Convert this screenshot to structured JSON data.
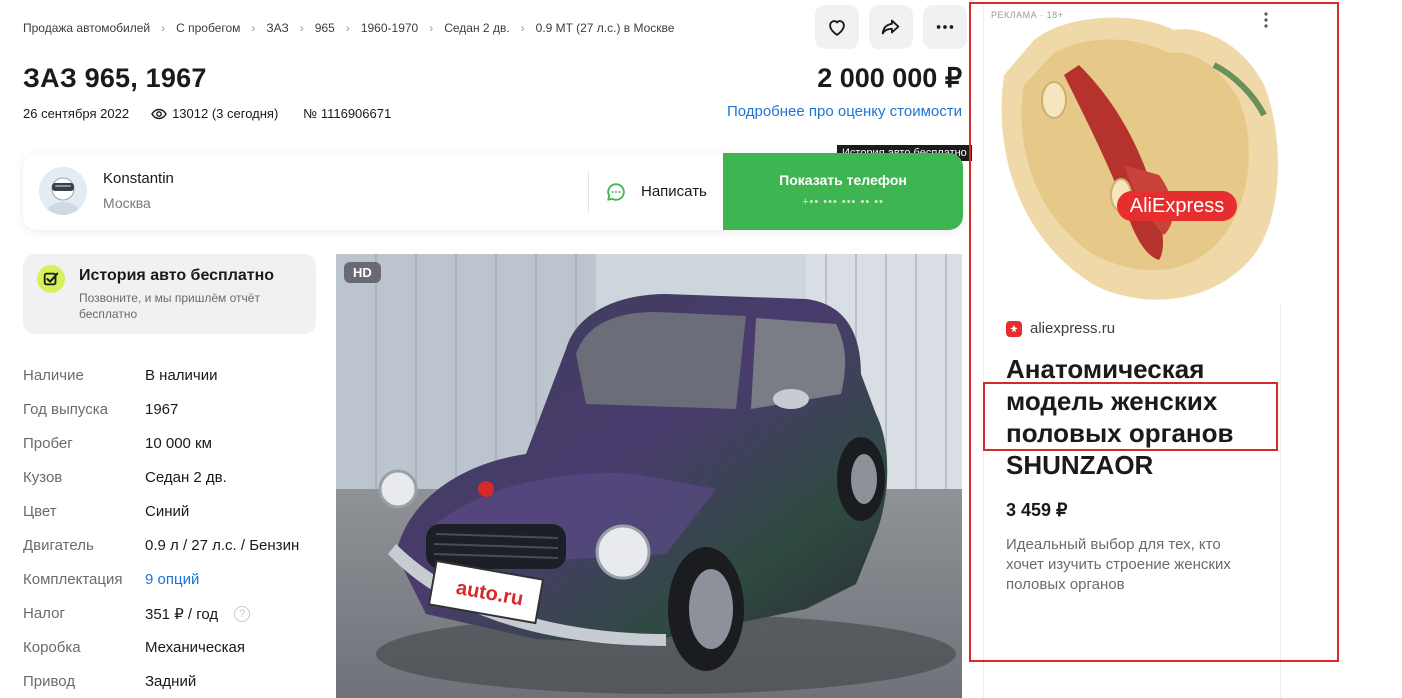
{
  "breadcrumbs": [
    "Продажа автомобилей",
    "С пробегом",
    "ЗАЗ",
    "965",
    "1960-1970",
    "Седан 2 дв.",
    "0.9 MT (27 л.с.) в Москве"
  ],
  "actions": {
    "favorite_icon": "heart-icon",
    "share_icon": "share-icon",
    "more_icon": "more-icon"
  },
  "listing": {
    "title": "ЗАЗ 965, 1967",
    "price": "2 000 000 ₽",
    "date": "26 сентября 2022",
    "views": "13012 (3 сегодня)",
    "number": "№ 1116906671",
    "estimate_link": "Подробнее про оценку стоимости"
  },
  "tooltip": "История авто бесплатно",
  "seller": {
    "name": "Konstantin",
    "city": "Москва",
    "write_label": "Написать",
    "phone_label": "Показать телефон",
    "phone_masked": "+•• ••• ••• •• ••"
  },
  "history": {
    "title": "История авто бесплатно",
    "subtitle": "Позвоните, и мы пришлём отчёт бесплатно"
  },
  "specs": [
    {
      "label": "Наличие",
      "value": "В наличии"
    },
    {
      "label": "Год выпуска",
      "value": "1967"
    },
    {
      "label": "Пробег",
      "value": "10 000 км"
    },
    {
      "label": "Кузов",
      "value": "Седан 2 дв."
    },
    {
      "label": "Цвет",
      "value": "Синий"
    },
    {
      "label": "Двигатель",
      "value": "0.9 л / 27 л.с. / Бензин"
    },
    {
      "label": "Комплектация",
      "value": "9 опций"
    },
    {
      "label": "Налог",
      "value": "351 ₽ / год"
    },
    {
      "label": "Коробка",
      "value": "Механическая"
    },
    {
      "label": "Привод",
      "value": "Задний"
    }
  ],
  "photo": {
    "badge": "HD",
    "plate_text": "auto.ru"
  },
  "ad": {
    "label": "РЕКЛАМА · 18+",
    "brand_badge": "AliExpress",
    "source": "aliexpress.ru",
    "title": "Анатомическая модель женских половых органов SHUNZAOR",
    "price": "3 459 ₽",
    "description": "Идеальный выбор для тех, кто хочет изучить строение женских половых органов"
  },
  "colors": {
    "accent_green": "#3fb551",
    "link_blue": "#1c74d6",
    "highlight_red": "#d42a2a",
    "history_badge": "#d5f15c"
  }
}
